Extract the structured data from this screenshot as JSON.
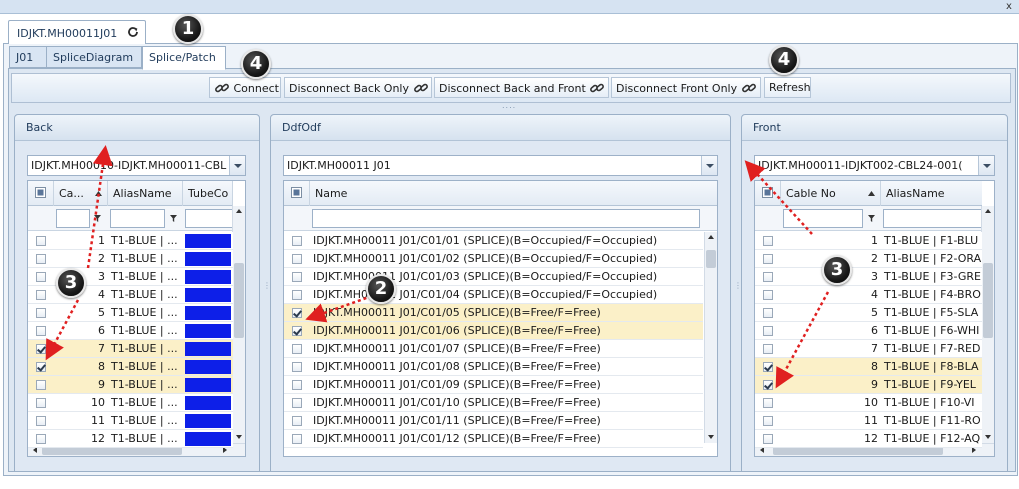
{
  "window": {
    "close_glyph": "x"
  },
  "outer_tab": {
    "label": "IDJKT.MH00011J01",
    "icon": "refresh-icon"
  },
  "inner_tabs": [
    {
      "label": "J01",
      "active": false
    },
    {
      "label": "SpliceDiagram",
      "active": false
    },
    {
      "label": "Splice/Patch",
      "active": true
    }
  ],
  "toolbar": {
    "connect": "Connect",
    "disconnect_back_only": "Disconnect Back Only",
    "disconnect_back_and_front": "Disconnect Back and Front",
    "disconnect_front_only": "Disconnect Front Only",
    "refresh": "Refresh",
    "grip": "....",
    "icon": "link-icon"
  },
  "back": {
    "title": "Back",
    "combo_value": "IDJKT.MH00010-IDJKT.MH00011-CBL",
    "columns": [
      "Ca...",
      "AliasName",
      "TubeCo"
    ],
    "rows": [
      {
        "no": "1",
        "alias": "T1-BLUE | ...",
        "checked": false,
        "selected": false
      },
      {
        "no": "2",
        "alias": "T1-BLUE | ...",
        "checked": false,
        "selected": false
      },
      {
        "no": "3",
        "alias": "T1-BLUE | ...",
        "checked": false,
        "selected": false
      },
      {
        "no": "4",
        "alias": "T1-BLUE | ...",
        "checked": false,
        "selected": false
      },
      {
        "no": "5",
        "alias": "T1-BLUE | ...",
        "checked": false,
        "selected": false
      },
      {
        "no": "6",
        "alias": "T1-BLUE | ...",
        "checked": false,
        "selected": false
      },
      {
        "no": "7",
        "alias": "T1-BLUE | ...",
        "checked": true,
        "selected": true
      },
      {
        "no": "8",
        "alias": "T1-BLUE | ...",
        "checked": true,
        "selected": true
      },
      {
        "no": "9",
        "alias": "T1-BLUE | ...",
        "checked": false,
        "selected": true
      },
      {
        "no": "10",
        "alias": "T1-BLUE | ...",
        "checked": false,
        "selected": false
      },
      {
        "no": "11",
        "alias": "T1-BLUE | ...",
        "checked": false,
        "selected": false
      },
      {
        "no": "12",
        "alias": "T1-BLUE | ...",
        "checked": false,
        "selected": false
      }
    ],
    "tube_color": "#0d1fe8"
  },
  "ddf": {
    "title": "DdfOdf",
    "combo_value": "IDJKT.MH00011 J01",
    "columns": [
      "Name"
    ],
    "rows": [
      {
        "name": "IDJKT.MH00011 J01/C01/01 (SPLICE)(B=Occupied/F=Occupied)",
        "checked": false,
        "selected": false
      },
      {
        "name": "IDJKT.MH00011 J01/C01/02 (SPLICE)(B=Occupied/F=Occupied)",
        "checked": false,
        "selected": false
      },
      {
        "name": "IDJKT.MH00011 J01/C01/03 (SPLICE)(B=Occupied/F=Occupied)",
        "checked": false,
        "selected": false
      },
      {
        "name": "IDJKT.MH00011 J01/C01/04 (SPLICE)(B=Occupied/F=Occupied)",
        "checked": false,
        "selected": false
      },
      {
        "name": "IDJKT.MH00011 J01/C01/05 (SPLICE)(B=Free/F=Free)",
        "checked": true,
        "selected": true
      },
      {
        "name": "IDJKT.MH00011 J01/C01/06 (SPLICE)(B=Free/F=Free)",
        "checked": true,
        "selected": true
      },
      {
        "name": "IDJKT.MH00011 J01/C01/07 (SPLICE)(B=Free/F=Free)",
        "checked": false,
        "selected": false
      },
      {
        "name": "IDJKT.MH00011 J01/C01/08 (SPLICE)(B=Free/F=Free)",
        "checked": false,
        "selected": false
      },
      {
        "name": "IDJKT.MH00011 J01/C01/09 (SPLICE)(B=Free/F=Free)",
        "checked": false,
        "selected": false
      },
      {
        "name": "IDJKT.MH00011 J01/C01/10 (SPLICE)(B=Free/F=Free)",
        "checked": false,
        "selected": false
      },
      {
        "name": "IDJKT.MH00011 J01/C01/11 (SPLICE)(B=Free/F=Free)",
        "checked": false,
        "selected": false
      },
      {
        "name": "IDJKT.MH00011 J01/C01/12 (SPLICE)(B=Free/F=Free)",
        "checked": false,
        "selected": false
      }
    ]
  },
  "front": {
    "title": "Front",
    "combo_value": "IDJKT.MH00011-IDJKT002-CBL24-001(",
    "columns": [
      "Cable No",
      "AliasName"
    ],
    "rows": [
      {
        "no": "1",
        "alias": "T1-BLUE | F1-BLU",
        "checked": false,
        "selected": false
      },
      {
        "no": "2",
        "alias": "T1-BLUE | F2-ORA",
        "checked": false,
        "selected": false
      },
      {
        "no": "3",
        "alias": "T1-BLUE | F3-GRE",
        "checked": false,
        "selected": false
      },
      {
        "no": "4",
        "alias": "T1-BLUE | F4-BRO",
        "checked": false,
        "selected": false
      },
      {
        "no": "5",
        "alias": "T1-BLUE | F5-SLA",
        "checked": false,
        "selected": false
      },
      {
        "no": "6",
        "alias": "T1-BLUE | F6-WHI",
        "checked": false,
        "selected": false
      },
      {
        "no": "7",
        "alias": "T1-BLUE | F7-RED",
        "checked": false,
        "selected": false
      },
      {
        "no": "8",
        "alias": "T1-BLUE | F8-BLA",
        "checked": true,
        "selected": true
      },
      {
        "no": "9",
        "alias": "T1-BLUE | F9-YEL",
        "checked": true,
        "selected": true
      },
      {
        "no": "10",
        "alias": "T1-BLUE | F10-VI",
        "checked": false,
        "selected": false
      },
      {
        "no": "11",
        "alias": "T1-BLUE | F11-RO",
        "checked": false,
        "selected": false
      },
      {
        "no": "12",
        "alias": "T1-BLUE | F12-AQ",
        "checked": false,
        "selected": false
      }
    ]
  },
  "callouts": [
    "1",
    "2",
    "3",
    "3",
    "4",
    "4"
  ],
  "colors": {
    "selected_row": "#fbf0c8",
    "callout_arrow": "#e02020",
    "accent": "#1f3a5a"
  }
}
